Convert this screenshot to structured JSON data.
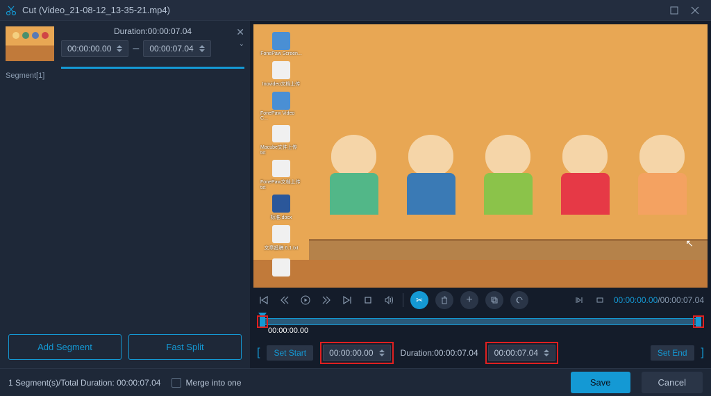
{
  "titlebar": {
    "title": "Cut (Video_21-08-12_13-35-21.mp4)"
  },
  "left": {
    "duration_label": "Duration:00:00:07.04",
    "start_time": "00:00:00.00",
    "end_time": "00:00:07.04",
    "segment_label": "Segment[1]",
    "add_segment": "Add Segment",
    "fast_split": "Fast Split"
  },
  "playback": {
    "current": "00:00:00.00",
    "total": "00:00:07.04"
  },
  "timeline": {
    "playhead_label": "00:00:00.00"
  },
  "setpoints": {
    "set_start": "Set Start",
    "start_time": "00:00:00.00",
    "duration_label": "Duration:00:00:07.04",
    "end_time": "00:00:07.04",
    "set_end": "Set End"
  },
  "footer": {
    "summary": "1 Segment(s)/Total Duration: 00:00:07.04",
    "merge_label": "Merge into one",
    "save": "Save",
    "cancel": "Cancel"
  }
}
